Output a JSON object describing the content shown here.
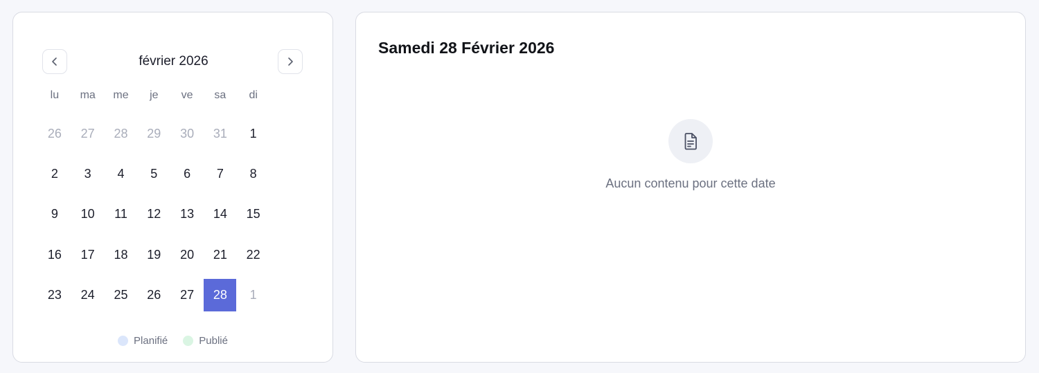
{
  "calendar": {
    "month_label": "février 2026",
    "prev_icon": "chevron-left-icon",
    "next_icon": "chevron-right-icon",
    "weekdays": [
      "lu",
      "ma",
      "me",
      "je",
      "ve",
      "sa",
      "di"
    ],
    "days": [
      {
        "label": "26",
        "outside": true
      },
      {
        "label": "27",
        "outside": true
      },
      {
        "label": "28",
        "outside": true
      },
      {
        "label": "29",
        "outside": true
      },
      {
        "label": "30",
        "outside": true
      },
      {
        "label": "31",
        "outside": true
      },
      {
        "label": "1",
        "outside": false
      },
      {
        "label": "2",
        "outside": false
      },
      {
        "label": "3",
        "outside": false
      },
      {
        "label": "4",
        "outside": false
      },
      {
        "label": "5",
        "outside": false
      },
      {
        "label": "6",
        "outside": false
      },
      {
        "label": "7",
        "outside": false
      },
      {
        "label": "8",
        "outside": false
      },
      {
        "label": "9",
        "outside": false
      },
      {
        "label": "10",
        "outside": false
      },
      {
        "label": "11",
        "outside": false
      },
      {
        "label": "12",
        "outside": false
      },
      {
        "label": "13",
        "outside": false
      },
      {
        "label": "14",
        "outside": false
      },
      {
        "label": "15",
        "outside": false
      },
      {
        "label": "16",
        "outside": false
      },
      {
        "label": "17",
        "outside": false
      },
      {
        "label": "18",
        "outside": false
      },
      {
        "label": "19",
        "outside": false
      },
      {
        "label": "20",
        "outside": false
      },
      {
        "label": "21",
        "outside": false
      },
      {
        "label": "22",
        "outside": false
      },
      {
        "label": "23",
        "outside": false
      },
      {
        "label": "24",
        "outside": false
      },
      {
        "label": "25",
        "outside": false
      },
      {
        "label": "26",
        "outside": false
      },
      {
        "label": "27",
        "outside": false
      },
      {
        "label": "28",
        "outside": false,
        "selected": true
      },
      {
        "label": "1",
        "outside": true
      }
    ],
    "legend": [
      {
        "label": "Planifié",
        "color": "#dbe6fb"
      },
      {
        "label": "Publié",
        "color": "#daf5e3"
      }
    ]
  },
  "detail": {
    "title": "Samedi 28 Février 2026",
    "empty_icon": "document-icon",
    "empty_text": "Aucun contenu pour cette date"
  },
  "colors": {
    "accent": "#5b6ad9",
    "muted_text": "#6b7080",
    "outside_day": "#a9adba"
  }
}
